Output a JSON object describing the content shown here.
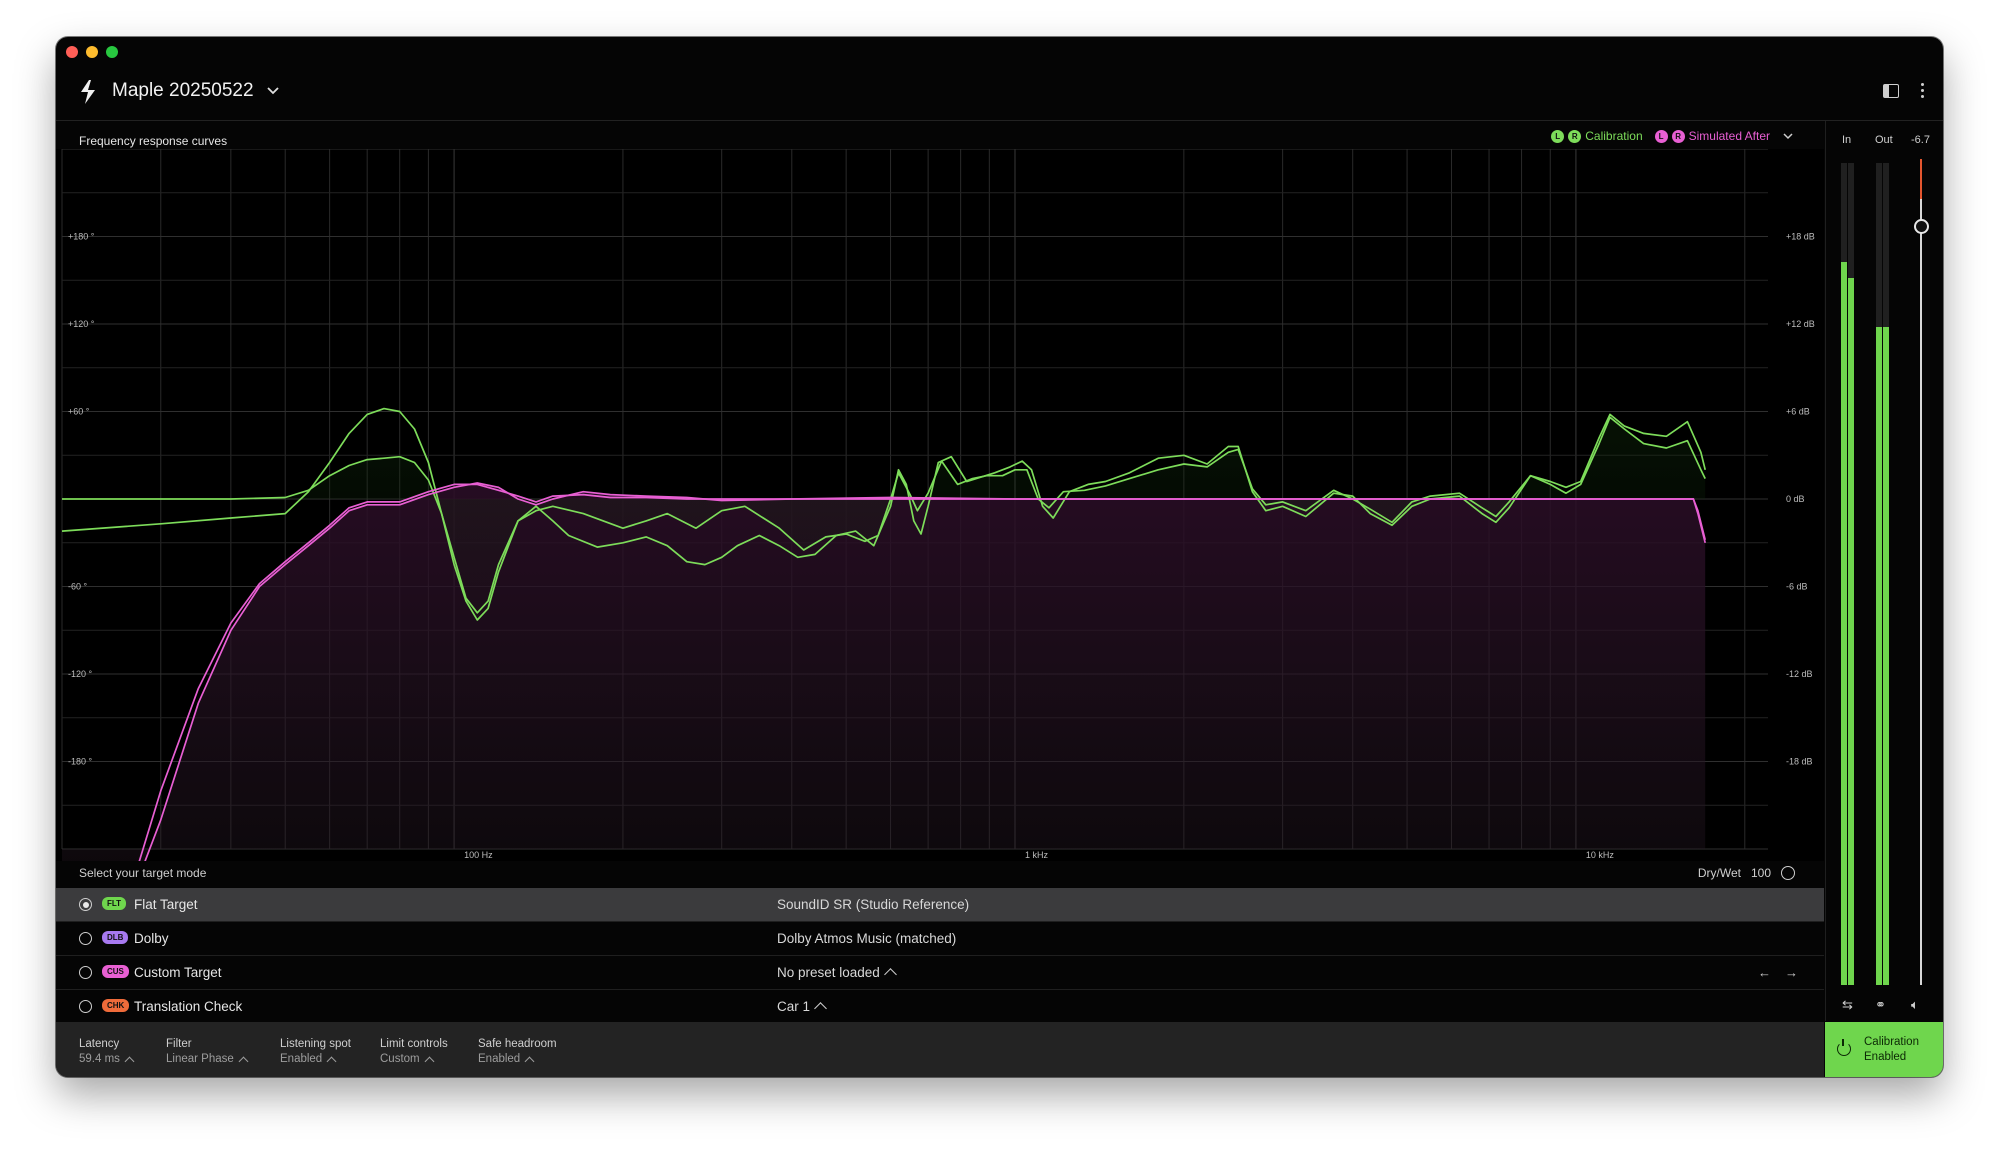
{
  "app": {
    "title": "Maple 20250522"
  },
  "chart_header": "Frequency response curves",
  "legend": {
    "calibration_label": "Calibration",
    "simulated_label": "Simulated After",
    "l": "L",
    "r": "R"
  },
  "colors": {
    "green": "#7ddc5a",
    "pink": "#e85fd3",
    "meter": "#6fd64d"
  },
  "meters": {
    "in_label": "In",
    "out_label": "Out",
    "out_level": "-6.7",
    "in_levels": [
      0.88,
      0.86
    ],
    "out_levels": [
      0.8,
      0.8
    ]
  },
  "target": {
    "prompt": "Select your target mode",
    "drywet_label": "Dry/Wet",
    "drywet_value": "100"
  },
  "rows": [
    {
      "badge": "FLT",
      "badge_color": "#6fd64d",
      "name": "Flat Target",
      "value": "SoundID SR (Studio Reference)",
      "selected": true
    },
    {
      "badge": "DLB",
      "badge_color": "#a779f0",
      "name": "Dolby",
      "value": "Dolby Atmos Music (matched)",
      "selected": false
    },
    {
      "badge": "CUS",
      "badge_color": "#e85fd3",
      "name": "Custom Target",
      "value": "No preset loaded",
      "selected": false
    },
    {
      "badge": "CHK",
      "badge_color": "#ef6b3a",
      "name": "Translation Check",
      "value": "Car 1",
      "selected": false
    }
  ],
  "bottom": [
    {
      "label": "Latency",
      "value": "59.4 ms"
    },
    {
      "label": "Filter",
      "value": "Linear Phase"
    },
    {
      "label": "Listening spot",
      "value": "Enabled"
    },
    {
      "label": "Limit controls",
      "value": "Custom"
    },
    {
      "label": "Safe headroom",
      "value": "Enabled"
    }
  ],
  "calibration_button": {
    "line1": "Calibration",
    "line2": "Enabled"
  },
  "chart_data": {
    "type": "line",
    "title": "Frequency response curves",
    "x_scale": "log",
    "xlim": [
      20,
      22000
    ],
    "x_tick_labels": [
      {
        "x": 100,
        "label": "100 Hz"
      },
      {
        "x": 1000,
        "label": "1 kHz"
      },
      {
        "x": 10000,
        "label": "10 kHz"
      }
    ],
    "left_axis": {
      "label": "phase",
      "ylim": [
        -240,
        240
      ],
      "tick_labels": [
        {
          "v": 180,
          "label": "+180 °"
        },
        {
          "v": 120,
          "label": "+120 °"
        },
        {
          "v": 60,
          "label": "+60 °"
        },
        {
          "v": -60,
          "label": "-60 °"
        },
        {
          "v": -120,
          "label": "-120 °"
        },
        {
          "v": -180,
          "label": "-180 °"
        }
      ]
    },
    "right_axis": {
      "ylim": [
        -24,
        24
      ],
      "tick_labels": [
        {
          "v": 18,
          "label": "+18 dB"
        },
        {
          "v": 12,
          "label": "+12 dB"
        },
        {
          "v": 6,
          "label": "+6 dB"
        },
        {
          "v": 0,
          "label": "0 dB"
        },
        {
          "v": -6,
          "label": "-6 dB"
        },
        {
          "v": -12,
          "label": "-12 dB"
        },
        {
          "v": -18,
          "label": "-18 dB"
        }
      ]
    },
    "grid": true,
    "series": [
      {
        "name": "Calibration L",
        "color": "#7ddc5a",
        "axis": "db",
        "points": [
          [
            20,
            -2.2
          ],
          [
            30,
            -1.7
          ],
          [
            40,
            -1.3
          ],
          [
            50,
            -1.0
          ],
          [
            55,
            0.5
          ],
          [
            60,
            2.5
          ],
          [
            65,
            4.5
          ],
          [
            70,
            5.8
          ],
          [
            75,
            6.2
          ],
          [
            80,
            6.0
          ],
          [
            85,
            4.8
          ],
          [
            90,
            2.5
          ],
          [
            95,
            -1.0
          ],
          [
            100,
            -4.5
          ],
          [
            105,
            -7.0
          ],
          [
            110,
            -8.3
          ],
          [
            115,
            -7.5
          ],
          [
            120,
            -5.0
          ],
          [
            130,
            -1.5
          ],
          [
            140,
            -0.5
          ],
          [
            150,
            -1.5
          ],
          [
            160,
            -2.5
          ],
          [
            180,
            -3.3
          ],
          [
            200,
            -3.0
          ],
          [
            220,
            -2.6
          ],
          [
            240,
            -3.2
          ],
          [
            260,
            -4.3
          ],
          [
            280,
            -4.5
          ],
          [
            300,
            -4.0
          ],
          [
            320,
            -3.2
          ],
          [
            350,
            -2.5
          ],
          [
            380,
            -3.2
          ],
          [
            410,
            -4.0
          ],
          [
            440,
            -3.8
          ],
          [
            480,
            -2.5
          ],
          [
            520,
            -2.2
          ],
          [
            560,
            -3.2
          ],
          [
            600,
            -0.5
          ],
          [
            620,
            2.0
          ],
          [
            640,
            1.0
          ],
          [
            660,
            -1.5
          ],
          [
            680,
            -2.4
          ],
          [
            700,
            -0.5
          ],
          [
            730,
            2.5
          ],
          [
            770,
            2.9
          ],
          [
            820,
            1.2
          ],
          [
            870,
            1.5
          ],
          [
            920,
            1.8
          ],
          [
            980,
            2.2
          ],
          [
            1030,
            2.6
          ],
          [
            1070,
            2.0
          ],
          [
            1120,
            -0.5
          ],
          [
            1170,
            -1.3
          ],
          [
            1250,
            0.5
          ],
          [
            1350,
            1.0
          ],
          [
            1450,
            1.2
          ],
          [
            1600,
            1.8
          ],
          [
            1800,
            2.8
          ],
          [
            2000,
            3.0
          ],
          [
            2200,
            2.4
          ],
          [
            2400,
            3.6
          ],
          [
            2500,
            3.6
          ],
          [
            2650,
            0.5
          ],
          [
            2800,
            -0.8
          ],
          [
            3000,
            -0.5
          ],
          [
            3300,
            -1.2
          ],
          [
            3700,
            0.4
          ],
          [
            4000,
            0.2
          ],
          [
            4300,
            -1.0
          ],
          [
            4700,
            -1.8
          ],
          [
            5100,
            -0.5
          ],
          [
            5500,
            0.0
          ],
          [
            6200,
            0.2
          ],
          [
            6800,
            -1.0
          ],
          [
            7200,
            -1.6
          ],
          [
            7600,
            -0.6
          ],
          [
            8300,
            1.6
          ],
          [
            9000,
            1.2
          ],
          [
            9600,
            0.8
          ],
          [
            10200,
            1.2
          ],
          [
            11000,
            4.2
          ],
          [
            11500,
            5.8
          ],
          [
            12200,
            5.0
          ],
          [
            13200,
            4.5
          ],
          [
            14500,
            4.3
          ],
          [
            15800,
            5.3
          ],
          [
            16700,
            3.2
          ],
          [
            17000,
            2.0
          ]
        ]
      },
      {
        "name": "Calibration R",
        "color": "#7ddc5a",
        "axis": "db",
        "points": [
          [
            20,
            0.0
          ],
          [
            40,
            0.0
          ],
          [
            50,
            0.1
          ],
          [
            55,
            0.6
          ],
          [
            60,
            1.6
          ],
          [
            65,
            2.3
          ],
          [
            70,
            2.7
          ],
          [
            75,
            2.8
          ],
          [
            80,
            2.9
          ],
          [
            85,
            2.5
          ],
          [
            90,
            1.3
          ],
          [
            95,
            -1.0
          ],
          [
            100,
            -4.0
          ],
          [
            105,
            -6.8
          ],
          [
            110,
            -7.8
          ],
          [
            115,
            -7.0
          ],
          [
            120,
            -4.5
          ],
          [
            130,
            -1.5
          ],
          [
            140,
            -0.8
          ],
          [
            150,
            -0.5
          ],
          [
            170,
            -1.0
          ],
          [
            200,
            -2.0
          ],
          [
            220,
            -1.5
          ],
          [
            240,
            -1.0
          ],
          [
            270,
            -2.0
          ],
          [
            300,
            -0.8
          ],
          [
            330,
            -0.5
          ],
          [
            380,
            -2.0
          ],
          [
            420,
            -3.5
          ],
          [
            460,
            -2.6
          ],
          [
            500,
            -2.4
          ],
          [
            540,
            -2.9
          ],
          [
            570,
            -2.5
          ],
          [
            600,
            0.0
          ],
          [
            620,
            1.8
          ],
          [
            650,
            0.3
          ],
          [
            670,
            -0.8
          ],
          [
            700,
            0.4
          ],
          [
            740,
            2.6
          ],
          [
            790,
            1.0
          ],
          [
            840,
            1.4
          ],
          [
            890,
            1.6
          ],
          [
            950,
            1.6
          ],
          [
            1000,
            2.0
          ],
          [
            1050,
            2.0
          ],
          [
            1100,
            0.0
          ],
          [
            1150,
            -0.6
          ],
          [
            1220,
            0.5
          ],
          [
            1330,
            0.6
          ],
          [
            1450,
            0.9
          ],
          [
            1600,
            1.4
          ],
          [
            1800,
            2.0
          ],
          [
            2000,
            2.4
          ],
          [
            2200,
            2.2
          ],
          [
            2400,
            3.2
          ],
          [
            2500,
            3.4
          ],
          [
            2650,
            0.7
          ],
          [
            2800,
            -0.4
          ],
          [
            3000,
            -0.2
          ],
          [
            3300,
            -0.8
          ],
          [
            3700,
            0.6
          ],
          [
            4000,
            0.0
          ],
          [
            4300,
            -0.7
          ],
          [
            4700,
            -1.6
          ],
          [
            5100,
            -0.2
          ],
          [
            5500,
            0.2
          ],
          [
            6200,
            0.4
          ],
          [
            6800,
            -0.6
          ],
          [
            7200,
            -1.2
          ],
          [
            7600,
            -0.2
          ],
          [
            8300,
            1.6
          ],
          [
            9000,
            1.0
          ],
          [
            9600,
            0.4
          ],
          [
            10200,
            1.0
          ],
          [
            11000,
            3.8
          ],
          [
            11500,
            5.6
          ],
          [
            12200,
            4.8
          ],
          [
            13200,
            3.8
          ],
          [
            14500,
            3.5
          ],
          [
            15800,
            4.0
          ],
          [
            16700,
            2.0
          ],
          [
            17000,
            1.4
          ]
        ]
      },
      {
        "name": "Simulated After L",
        "color": "#e85fd3",
        "axis": "db",
        "points": [
          [
            20,
            -42
          ],
          [
            25,
            -32
          ],
          [
            30,
            -22
          ],
          [
            35,
            -14
          ],
          [
            40,
            -9
          ],
          [
            45,
            -6
          ],
          [
            50,
            -4.5
          ],
          [
            55,
            -3.2
          ],
          [
            60,
            -2.0
          ],
          [
            65,
            -0.8
          ],
          [
            70,
            -0.4
          ],
          [
            80,
            -0.4
          ],
          [
            90,
            0.3
          ],
          [
            100,
            0.8
          ],
          [
            110,
            1.1
          ],
          [
            120,
            0.8
          ],
          [
            130,
            0.0
          ],
          [
            140,
            -0.4
          ],
          [
            150,
            0.0
          ],
          [
            170,
            0.5
          ],
          [
            190,
            0.3
          ],
          [
            220,
            0.2
          ],
          [
            260,
            0.1
          ],
          [
            300,
            -0.1
          ],
          [
            400,
            0.0
          ],
          [
            600,
            0.1
          ],
          [
            1000,
            0.0
          ],
          [
            2000,
            0.0
          ],
          [
            5000,
            0.0
          ],
          [
            10000,
            0.0
          ],
          [
            15000,
            0.0
          ],
          [
            16200,
            0.0
          ],
          [
            16500,
            -1.0
          ],
          [
            17000,
            -3.0
          ]
        ]
      },
      {
        "name": "Simulated After R",
        "color": "#e85fd3",
        "axis": "db",
        "points": [
          [
            20,
            -40
          ],
          [
            25,
            -30
          ],
          [
            30,
            -20
          ],
          [
            35,
            -13
          ],
          [
            40,
            -8.5
          ],
          [
            45,
            -5.8
          ],
          [
            50,
            -4.3
          ],
          [
            55,
            -3.0
          ],
          [
            60,
            -1.8
          ],
          [
            65,
            -0.6
          ],
          [
            70,
            -0.2
          ],
          [
            80,
            -0.2
          ],
          [
            90,
            0.5
          ],
          [
            100,
            1.0
          ],
          [
            110,
            1.0
          ],
          [
            120,
            0.6
          ],
          [
            130,
            0.2
          ],
          [
            140,
            -0.2
          ],
          [
            150,
            0.2
          ],
          [
            170,
            0.3
          ],
          [
            190,
            0.1
          ],
          [
            220,
            0.1
          ],
          [
            260,
            0.0
          ],
          [
            300,
            0.0
          ],
          [
            400,
            0.0
          ],
          [
            600,
            0.0
          ],
          [
            1000,
            0.0
          ],
          [
            2000,
            0.0
          ],
          [
            5000,
            0.0
          ],
          [
            10000,
            0.0
          ],
          [
            15000,
            0.0
          ],
          [
            16200,
            0.0
          ],
          [
            16500,
            -0.8
          ],
          [
            17000,
            -2.8
          ]
        ]
      }
    ]
  }
}
